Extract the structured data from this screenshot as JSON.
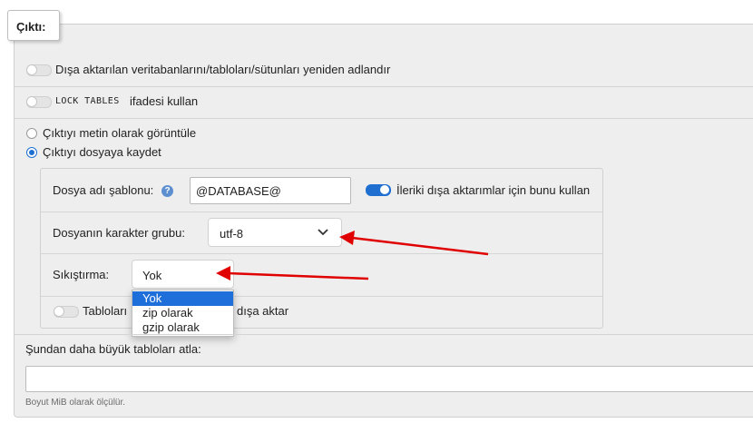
{
  "output": {
    "legend": "Çıktı:",
    "rename_label": "Dışa aktarılan veritabanlarını/tabloları/sütunları yeniden adlandır",
    "lock_tables_code": "LOCK TABLES",
    "lock_tables_label": "ifadesi kullan",
    "radio_text": "Çıktıyı metin olarak görüntüle",
    "radio_file": "Çıktıyı dosyaya kaydet",
    "filename_label": "Dosya adı şablonu:",
    "filename_value": "@DATABASE@",
    "remember_label": "İleriki dışa aktarımlar için bunu kullan",
    "charset_label": "Dosyanın karakter grubu:",
    "charset_value": "utf-8",
    "compression_label": "Sıkıştırma:",
    "compression_value": "Yok",
    "compression_options": [
      "Yok",
      "zip olarak",
      "gzip olarak"
    ],
    "separate_files_label_start": "Tabloları ",
    "separate_files_label_end": "dışa aktar",
    "skip_tables_label": "Şundan daha büyük tabloları atla:",
    "skip_tables_value": "",
    "skip_tables_hint": "Boyut MiB olarak ölçülür."
  },
  "annotation_color": "#e00000",
  "accent_color": "#1f6fd1"
}
